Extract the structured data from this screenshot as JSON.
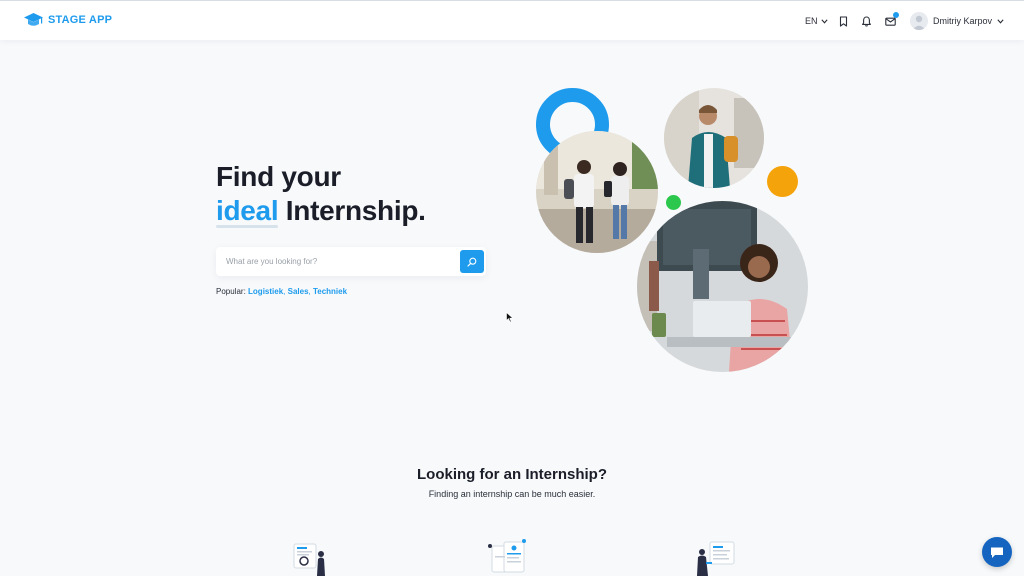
{
  "header": {
    "logo_text": "STAGE APP",
    "logo_icon": "graduation-cap-icon",
    "language": "EN",
    "icons": [
      "bookmark-icon",
      "bell-icon",
      "mail-icon"
    ],
    "user_name": "Dmitriy Karpov"
  },
  "hero": {
    "title_line1": "Find your",
    "title_accent": "ideal",
    "title_rest": " Internship.",
    "search_placeholder": "What are you looking for?",
    "popular_label": "Popular:",
    "popular_links": [
      "Logistiek",
      "Sales",
      "Techniek"
    ]
  },
  "section": {
    "title": "Looking for an Internship?",
    "subtitle": "Finding an internship can be much easier."
  },
  "colors": {
    "accent": "#1e9bed",
    "orange": "#f5a30b",
    "green": "#2cc84d",
    "chat": "#1565c0"
  }
}
